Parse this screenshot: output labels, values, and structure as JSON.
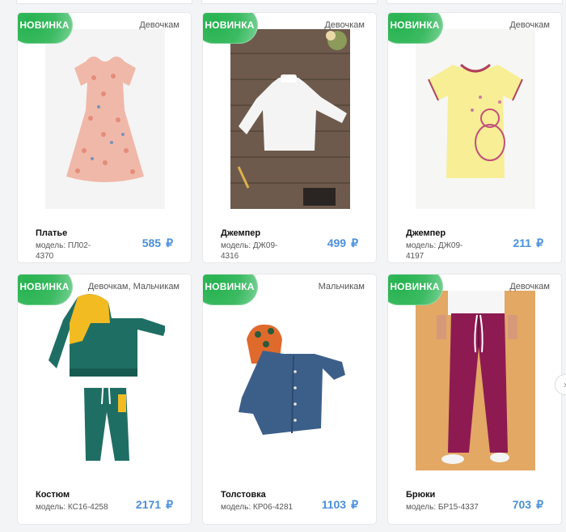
{
  "badge_label": "НОВИНКА",
  "currency_symbol": "₽",
  "products": [
    {
      "title": "Платье",
      "model": "модель: ПЛ02-4370",
      "price": "585",
      "category": "Девочкам",
      "image": "dress-photo"
    },
    {
      "title": "Джемпер",
      "model": "модель: ДЖ09-4316",
      "price": "499",
      "category": "Девочкам",
      "image": "white-blouse-photo"
    },
    {
      "title": "Джемпер",
      "model": "модель: ДЖ09-4197",
      "price": "211",
      "category": "Девочкам",
      "image": "yellow-tshirt-photo"
    },
    {
      "title": "Костюм",
      "model": "модель: КС16-4258",
      "price": "2171",
      "category": "Девочкам, Мальчикам",
      "image": "tracksuit-photo"
    },
    {
      "title": "Толстовка",
      "model": "модель: КР06-4281",
      "price": "1103",
      "category": "Мальчикам",
      "image": "denim-shirt-photo"
    },
    {
      "title": "Брюки",
      "model": "модель: БР15-4337",
      "price": "703",
      "category": "Девочкам",
      "image": "burgundy-pants-photo"
    }
  ],
  "colors": {
    "badge": "#2db355",
    "price": "#4a8fdc",
    "background": "#f3f4f5"
  }
}
